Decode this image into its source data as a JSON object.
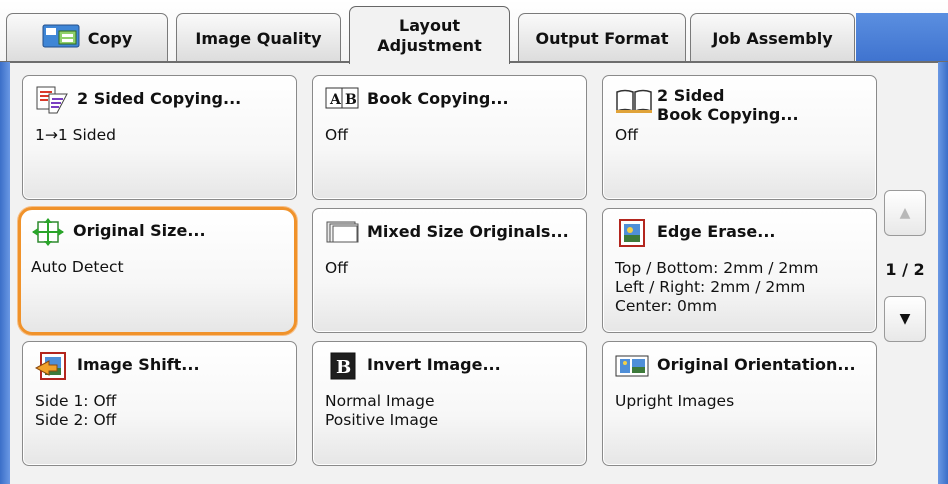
{
  "tabs": [
    {
      "label": "Copy",
      "icon": "copy-icon"
    },
    {
      "label": "Image Quality"
    },
    {
      "label_line1": "Layout",
      "label_line2": "Adjustment",
      "active": true
    },
    {
      "label": "Output Format"
    },
    {
      "label": "Job Assembly"
    }
  ],
  "buttons": [
    {
      "title": "2 Sided Copying...",
      "icon": "two-sided-copying-icon",
      "values": [
        "1→1 Sided"
      ]
    },
    {
      "title": "Book Copying...",
      "icon": "book-copying-icon",
      "icon_text": "A|B",
      "values": [
        "Off"
      ]
    },
    {
      "title_line1": "2 Sided",
      "title_line2": "Book Copying...",
      "icon": "open-book-icon",
      "values": [
        "Off"
      ]
    },
    {
      "title": "Original Size...",
      "icon": "original-size-icon",
      "values": [
        "Auto Detect"
      ],
      "selected": true
    },
    {
      "title": "Mixed Size Originals...",
      "icon": "mixed-size-icon",
      "values": [
        "Off"
      ]
    },
    {
      "title": "Edge Erase...",
      "icon": "edge-erase-icon",
      "values": [
        "Top / Bottom: 2mm / 2mm",
        "Left / Right: 2mm / 2mm",
        "Center: 0mm"
      ]
    },
    {
      "title": "Image Shift...",
      "icon": "image-shift-icon",
      "values": [
        "Side 1: Off",
        "Side 2: Off"
      ]
    },
    {
      "title": "Invert Image...",
      "icon": "invert-image-icon",
      "icon_text": "B",
      "values": [
        "Normal Image",
        "Positive Image"
      ]
    },
    {
      "title": "Original Orientation...",
      "icon": "original-orientation-icon",
      "values": [
        "Upright Images"
      ]
    }
  ],
  "pager": {
    "indicator": "1 / 2",
    "up": "▲",
    "down": "▼"
  },
  "colors": {
    "accent_blue": "#4a7fd6",
    "selection_orange": "#f0922a"
  }
}
